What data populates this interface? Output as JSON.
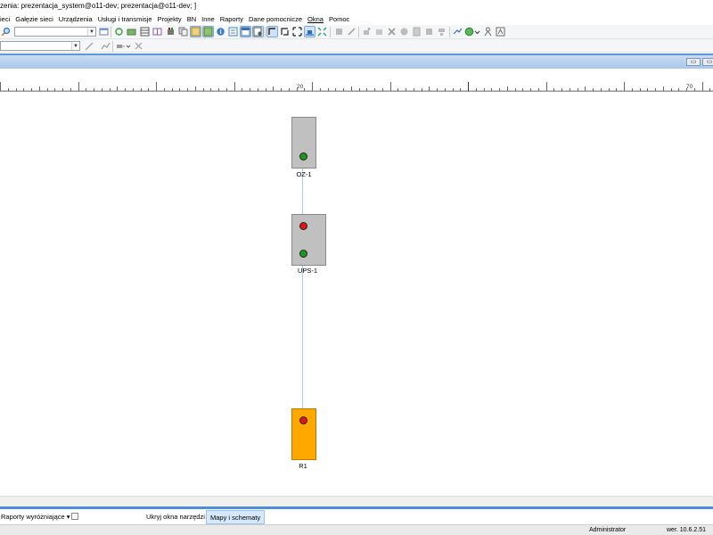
{
  "window": {
    "title": "zenia: prezentacja_system@o11-dev; prezentacja@o11-dev; ]"
  },
  "menu": {
    "items": [
      "ieci",
      "Gałęzie sieci",
      "Urządzenia",
      "Usługi i transmisje",
      "Projekty",
      "BN",
      "Inne",
      "Raporty",
      "Dane pomocnicze",
      "Okna",
      "Pomoc"
    ]
  },
  "toolbar": {
    "combo_value": ""
  },
  "ruler": {
    "labels": [
      "20",
      "70"
    ]
  },
  "diagram": {
    "nodes": [
      {
        "label": "OZ-1",
        "color": "#c0c0c0",
        "leds": [
          "green"
        ]
      },
      {
        "label": "UPS-1",
        "color": "#c0c0c0",
        "leds": [
          "red",
          "green"
        ]
      },
      {
        "label": "R1",
        "color": "#ffa800",
        "leds": [
          "red"
        ]
      }
    ],
    "link_color": "#a9cfe8"
  },
  "bottom": {
    "reports_label": "Raporty wyróżniające",
    "hide_tools_label": "Ukryj okna narzędzi",
    "active_tab_label": "Mapy i schematy"
  },
  "status": {
    "user": "Administrator",
    "version": "wer. 10.6.2.51"
  },
  "colors": {
    "accent": "#4c8fd8",
    "header": "#a9c7ea"
  }
}
